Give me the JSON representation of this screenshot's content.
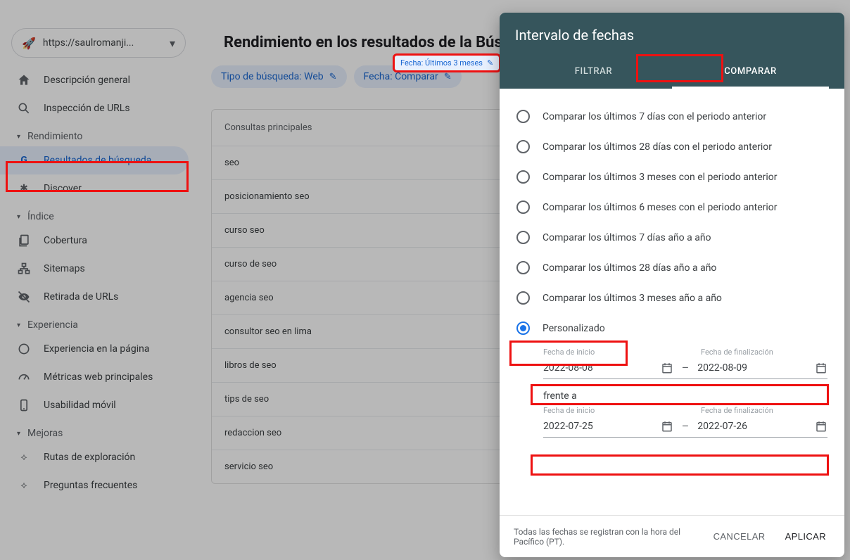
{
  "property": {
    "url": "https://saulromanji..."
  },
  "nav": {
    "overview": "Descripción general",
    "url_inspect": "Inspección de URLs",
    "sec_perf": "Rendimiento",
    "search_results": "Resultados de búsqueda",
    "discover": "Discover",
    "sec_index": "Índice",
    "coverage": "Cobertura",
    "sitemaps": "Sitemaps",
    "removals": "Retirada de URLs",
    "sec_exp": "Experiencia",
    "page_exp": "Experiencia en la página",
    "cwv": "Métricas web principales",
    "mobile": "Usabilidad móvil",
    "sec_enh": "Mejoras",
    "breadcrumbs": "Rutas de exploración",
    "faq": "Preguntas frecuentes"
  },
  "page": {
    "title": "Rendimiento en los resultados de la Búsqueda",
    "chip_type": "Tipo de búsqueda: Web",
    "chip_compare": "Fecha: Comparar",
    "chip_date_hl": "Fecha: Últimos 3 meses"
  },
  "table": {
    "header": "Consultas principales",
    "rows": [
      "seo",
      "posicionamiento seo",
      "curso seo",
      "curso de seo",
      "agencia seo",
      "consultor seo en lima",
      "libros de seo",
      "tips de seo",
      "redaccion seo",
      "servicio seo"
    ]
  },
  "modal": {
    "title": "Intervalo de fechas",
    "tab_filter": "FILTRAR",
    "tab_compare": "COMPARAR",
    "options": [
      "Comparar los últimos 7 días con el periodo anterior",
      "Comparar los últimos 28 días con el periodo anterior",
      "Comparar los últimos 3 meses con el periodo anterior",
      "Comparar los últimos 6 meses con el periodo anterior",
      "Comparar los últimos 7 días año a año",
      "Comparar los últimos 28 días año a año",
      "Comparar los últimos 3 meses año a año"
    ],
    "custom": "Personalizado",
    "start_label": "Fecha de inicio",
    "end_label": "Fecha de finalización",
    "r1_start": "2022-08-08",
    "r1_end": "2022-08-09",
    "vs": "frente a",
    "r2_start": "2022-07-25",
    "r2_end": "2022-07-26",
    "footnote": "Todas las fechas se registran con la hora del Pacífico (PT).",
    "cancel": "CANCELAR",
    "apply": "APLICAR"
  }
}
